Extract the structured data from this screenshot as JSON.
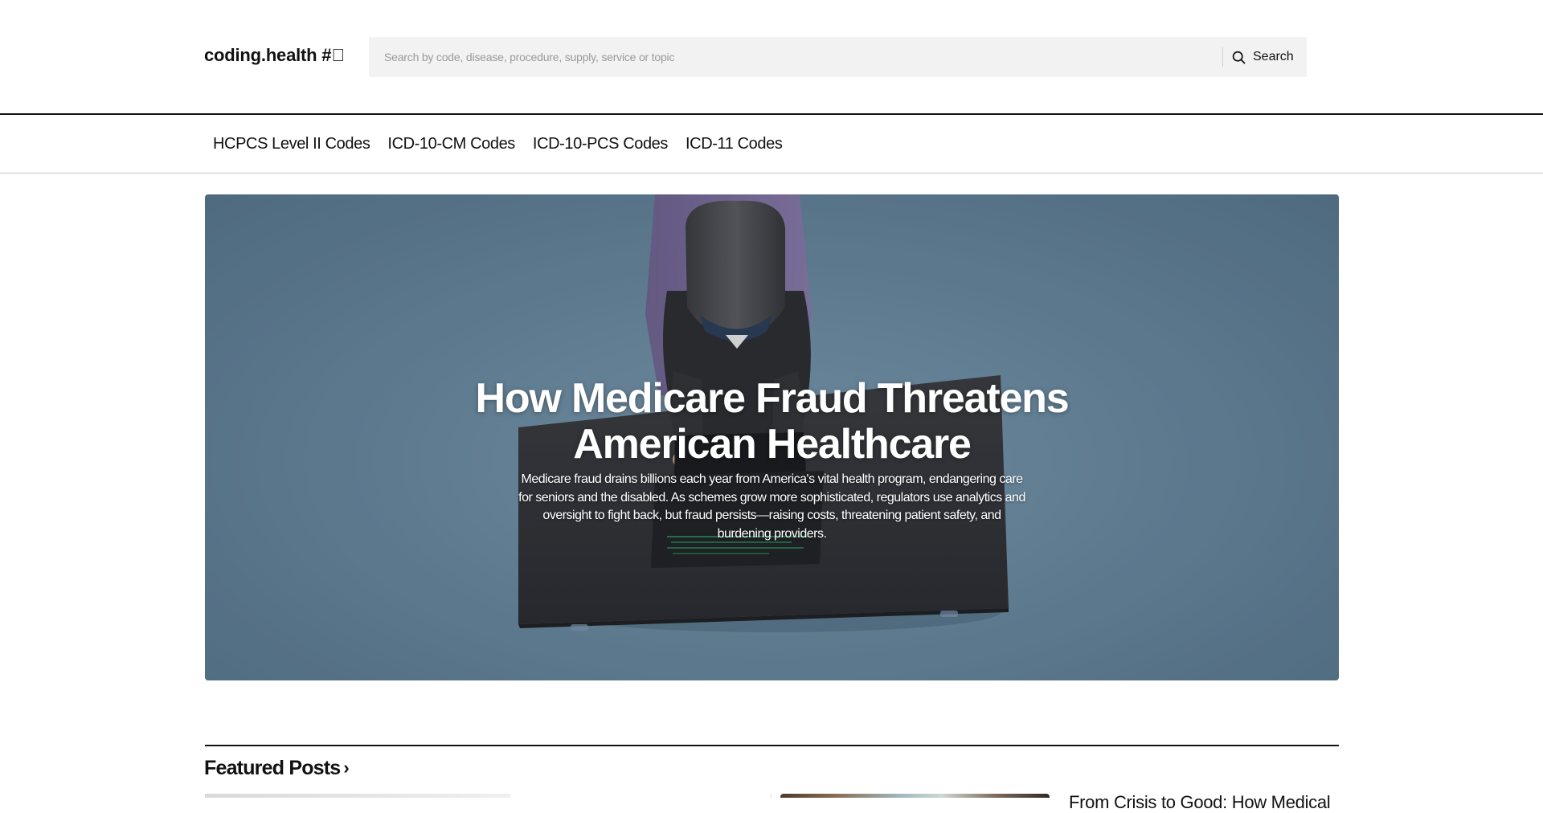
{
  "header": {
    "logo": "coding.health #⃣",
    "search": {
      "placeholder": "Search by code, disease, procedure, supply, service or topic",
      "value": "",
      "button_label": "Search"
    }
  },
  "nav": {
    "items": [
      {
        "label": "HCPCS Level II Codes"
      },
      {
        "label": "ICD-10-CM Codes"
      },
      {
        "label": "ICD-10-PCS Codes"
      },
      {
        "label": "ICD-11 Codes"
      }
    ]
  },
  "hero": {
    "title": "How Medicare Fraud Threatens American Healthcare",
    "excerpt": "Medicare fraud drains billions each year from America's vital health program, endangering care for seniors and the disabled. As schemes grow more sophisticated, regulators use analytics and oversight to fight back, but fraud persists—raising costs, threatening patient safety, and burdening providers.",
    "image_subject": "hooded-figure-at-laptop-illustration"
  },
  "featured": {
    "heading": "Featured Posts",
    "chevron_icon": "chevron-right-icon",
    "second_card_title": "From Crisis to Good: How Medical"
  },
  "colors": {
    "text": "#111111",
    "search_bg": "#f2f2f2",
    "hero_bg": "#6a889d",
    "nav_border": "#e9e9e9"
  }
}
